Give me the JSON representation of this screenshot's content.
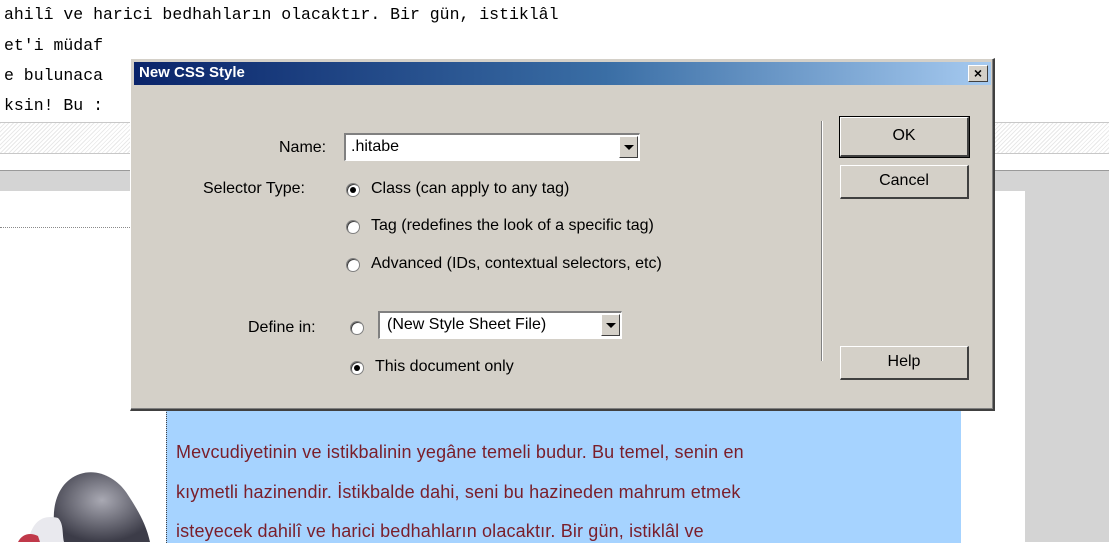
{
  "code_view": {
    "lines": [
      "ahilî ve harici bedhahların olacaktır. Bir gün, istiklâl",
      "et'i müdaf",
      "e bulunaca",
      "ksin! Bu :"
    ]
  },
  "design_view": {
    "lines": [
      "Mevcudiyetinin ve istikbalinin yegâne temeli budur. Bu temel, senin en",
      "kıymetli hazinendir. İstikbalde dahi, seni bu hazineden mahrum etmek",
      "isteyecek dahilî ve harici bedhahların olacaktır. Bir gün, istiklâl ve"
    ]
  },
  "dialog": {
    "title": "New CSS Style",
    "close_symbol": "×",
    "name_label": "Name:",
    "name_value": ".hitabe",
    "selector_type_label": "Selector Type:",
    "selector_options": [
      {
        "label": "Class (can apply to any tag)",
        "selected": true
      },
      {
        "label": "Tag (redefines the look of a specific tag)",
        "selected": false
      },
      {
        "label": "Advanced (IDs, contextual selectors, etc)",
        "selected": false
      }
    ],
    "define_in_label": "Define in:",
    "define_in_file_value": "(New Style Sheet File)",
    "define_in_doc_label": "This document only",
    "define_in_selected": "This document only",
    "buttons": {
      "ok": "OK",
      "cancel": "Cancel",
      "help": "Help"
    }
  },
  "colors": {
    "dialog_face": "#d4d0c8",
    "titlebar_start": "#0a246a",
    "titlebar_end": "#a6caf0",
    "selection_bg": "#a6d3ff",
    "body_text": "#7a1e2a"
  }
}
